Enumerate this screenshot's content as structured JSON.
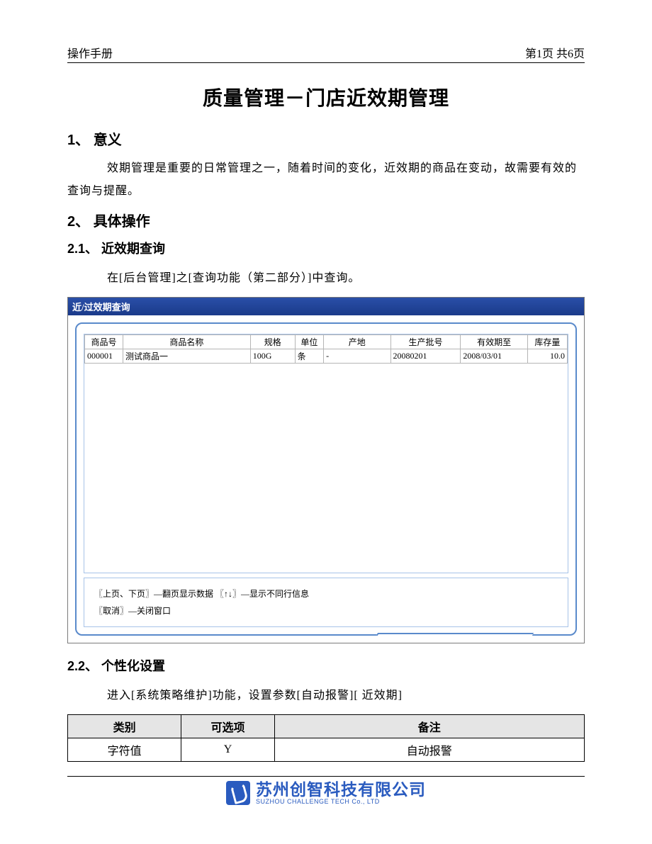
{
  "header": {
    "left": "操作手册",
    "right": "第1页  共6页"
  },
  "title": "质量管理－门店近效期管理",
  "sec1": {
    "num": "1、",
    "label": "意义"
  },
  "para1": "效期管理是重要的日常管理之一，随着时间的变化，近效期的商品在变动，故需要有效的查询与提醒。",
  "sec2": {
    "num": "2、",
    "label": "具体操作"
  },
  "sec21": {
    "num": "2.1、",
    "label": "近效期查询"
  },
  "para21": "在[后台管理]之[查询功能（第二部分）]中查询。",
  "app": {
    "title": "近/过效期查询",
    "columns": [
      "商品号",
      "商品名称",
      "规格",
      "单位",
      "产地",
      "生产批号",
      "有效期至",
      "库存量"
    ],
    "row": {
      "id": "000001",
      "name": "测试商品一",
      "spec": "100G",
      "unit": "条",
      "origin": "-",
      "batch": "20080201",
      "valid": "2008/03/01",
      "stock": "10.0"
    },
    "hint1": "〖上页、下页〗—翻页显示数据      〖↑↓〗—显示不同行信息",
    "hint2": "〖取消〗—关闭窗口"
  },
  "sec22": {
    "num": "2.2、",
    "label": "个性化设置"
  },
  "para22": "进入[系统策略维护]功能，设置参数[自动报警][ 近效期]",
  "settings": {
    "headers": [
      "类别",
      "可选项",
      "备注"
    ],
    "row": [
      "字符值",
      "Y",
      "自动报警"
    ]
  },
  "footer": {
    "company_cn": "苏州创智科技有限公司",
    "company_en": "SUZHOU CHALLENGE TECH Co., LTD"
  }
}
